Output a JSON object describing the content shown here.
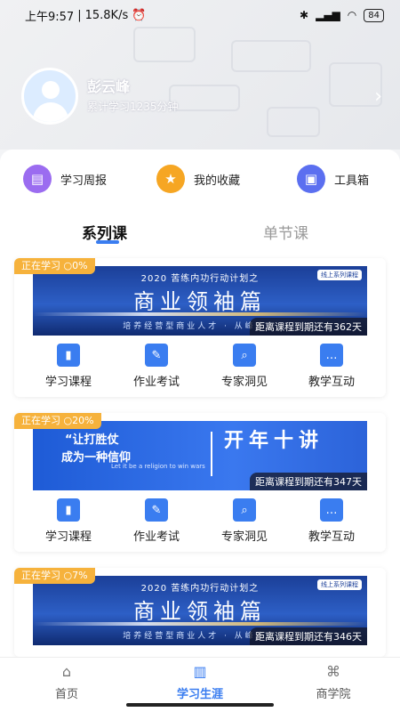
{
  "status": {
    "time": "上午9:57",
    "speed": "15.8K/s",
    "battery": "84"
  },
  "profile": {
    "name": "彭云峰",
    "subtitle": "累计学习1235分钟"
  },
  "quick": [
    {
      "label": "学习周报",
      "icon": "report-icon",
      "color": "#9b6cf0"
    },
    {
      "label": "我的收藏",
      "icon": "star-icon",
      "color": "#f6a623"
    },
    {
      "label": "工具箱",
      "icon": "toolbox-icon",
      "color": "#5b6ff0"
    }
  ],
  "tabs": [
    {
      "label": "系列课"
    },
    {
      "label": "单节课"
    }
  ],
  "cards": [
    {
      "badge": "正在学习",
      "progress": "0%",
      "expire": "距离课程到期还有362天",
      "banner": {
        "title": "2020 苦练内功行动计划之",
        "big": "商业领袖篇",
        "sub": "培养经营型商业人才 · 从峰度入",
        "tag": "线上系列课程"
      }
    },
    {
      "badge": "正在学习",
      "progress": "20%",
      "expire": "距离课程到期还有347天",
      "banner": {
        "line1": "“让打胜仗",
        "line2": "成为一种信仰",
        "line3": "Let it be a religion to win wars",
        "big": "开年十讲"
      }
    },
    {
      "badge": "正在学习",
      "progress": "7%",
      "expire": "距离课程到期还有346天",
      "banner": {
        "title": "2020 苦练内功行动计划之",
        "big": "商业领袖篇",
        "sub": "培养经营型商业人才 · 从峰度入",
        "tag": "线上系列课程"
      }
    }
  ],
  "actions": [
    {
      "label": "学习课程",
      "icon": "book-icon"
    },
    {
      "label": "作业考试",
      "icon": "edit-icon"
    },
    {
      "label": "专家洞见",
      "icon": "search-doc-icon"
    },
    {
      "label": "教学互动",
      "icon": "chat-icon"
    }
  ],
  "nav": [
    {
      "label": "首页",
      "icon": "home-icon"
    },
    {
      "label": "学习生涯",
      "icon": "study-icon"
    },
    {
      "label": "商学院",
      "icon": "school-icon"
    }
  ]
}
